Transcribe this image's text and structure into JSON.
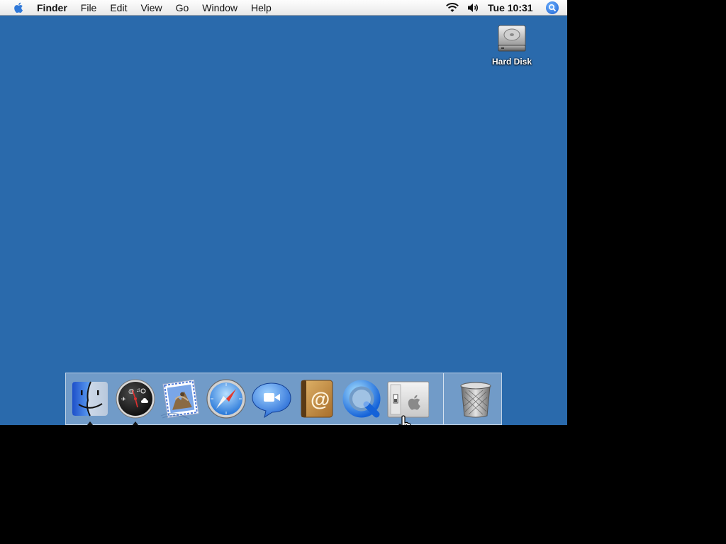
{
  "menubar": {
    "app_name": "Finder",
    "menus": [
      "File",
      "Edit",
      "View",
      "Go",
      "Window",
      "Help"
    ],
    "clock": "Tue 10:31",
    "icons": {
      "apple": "apple-logo-icon",
      "wifi": "wifi-icon",
      "volume": "volume-icon",
      "spotlight": "spotlight-search-icon"
    }
  },
  "desktop": {
    "background_color": "#2a6aac",
    "icons": [
      {
        "label": "Hard Disk",
        "icon": "hard-disk-icon"
      }
    ]
  },
  "dock": {
    "items": [
      {
        "icon": "finder-icon",
        "running": true
      },
      {
        "icon": "dashboard-icon",
        "running": true
      },
      {
        "icon": "mail-icon",
        "running": false
      },
      {
        "icon": "safari-icon",
        "running": false
      },
      {
        "icon": "ichat-icon",
        "running": false
      },
      {
        "icon": "address-book-icon",
        "running": false
      },
      {
        "icon": "quicktime-icon",
        "running": false
      },
      {
        "icon": "system-preferences-icon",
        "running": false
      }
    ],
    "trash": {
      "icon": "trash-icon"
    }
  },
  "cursor": {
    "icon": "pointing-hand-cursor-icon"
  }
}
